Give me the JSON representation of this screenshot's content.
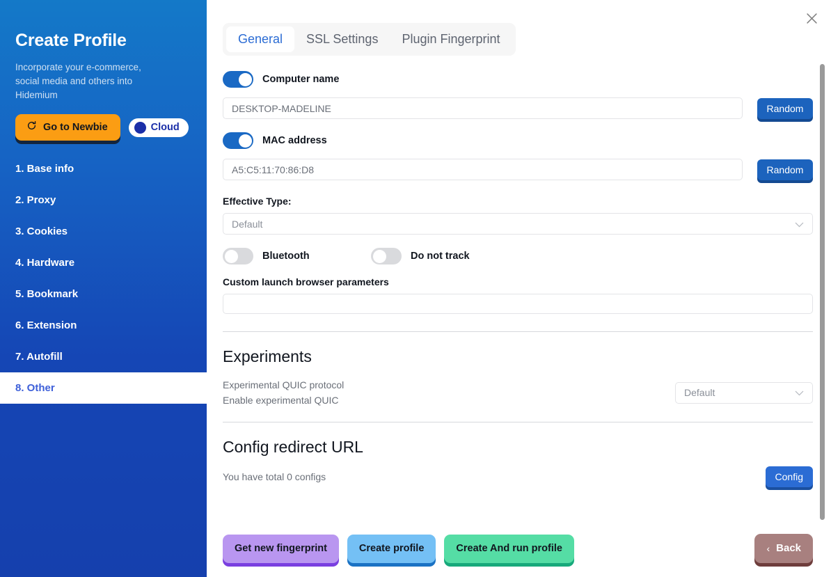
{
  "sidebar": {
    "title": "Create Profile",
    "subtitle": "Incorporate your e-commerce, social media and others into Hidemium",
    "newbie_button": "Go to Newbie",
    "newbie_icon": "refresh-icon",
    "cloud_badge": "Cloud",
    "items": [
      {
        "label": "1. Base info",
        "active": false
      },
      {
        "label": "2. Proxy",
        "active": false
      },
      {
        "label": "3. Cookies",
        "active": false
      },
      {
        "label": "4. Hardware",
        "active": false
      },
      {
        "label": "5. Bookmark",
        "active": false
      },
      {
        "label": "6. Extension",
        "active": false
      },
      {
        "label": "7. Autofill",
        "active": false
      },
      {
        "label": "8. Other",
        "active": true
      }
    ],
    "colors": {
      "bg_top": "#1479c8",
      "bg_bottom": "#1540ad",
      "active_text": "#3d5fd9",
      "newbie_bg": "#fb9d13",
      "cloud_dot": "#1b2fa8"
    }
  },
  "header": {
    "close_icon": "close-icon"
  },
  "tabs": [
    {
      "label": "General",
      "active": true
    },
    {
      "label": "SSL Settings",
      "active": false
    },
    {
      "label": "Plugin Fingerprint",
      "active": false
    }
  ],
  "general": {
    "computer_name": {
      "toggle_label": "Computer name",
      "toggle_on": true,
      "value": "DESKTOP-MADELINE",
      "random_label": "Random"
    },
    "mac_address": {
      "toggle_label": "MAC address",
      "toggle_on": true,
      "value": "A5:C5:11:70:86:D8",
      "random_label": "Random"
    },
    "effective_type": {
      "label": "Effective Type:",
      "value": "Default",
      "chevron_icon": "chevron-down-icon"
    },
    "bluetooth": {
      "label": "Bluetooth",
      "on": false
    },
    "do_not_track": {
      "label": "Do not track",
      "on": false
    },
    "custom_params": {
      "label": "Custom launch browser parameters",
      "value": ""
    }
  },
  "experiments": {
    "title": "Experiments",
    "quic_line1": "Experimental QUIC protocol",
    "quic_line2": "Enable experimental QUIC",
    "quic_value": "Default",
    "chevron_icon": "chevron-down-icon"
  },
  "config_redirect": {
    "title": "Config redirect URL",
    "note": "You have total 0 configs",
    "button": "Config"
  },
  "footer": {
    "get_fingerprint": "Get new fingerprint",
    "create_profile": "Create profile",
    "create_and_run": "Create And run profile",
    "back": "Back",
    "back_icon": "chevron-left-icon",
    "colors": {
      "fingerprint": "#b996f0",
      "create": "#74c0f5",
      "create_run": "#55dda5",
      "back": "#a8807f"
    }
  }
}
